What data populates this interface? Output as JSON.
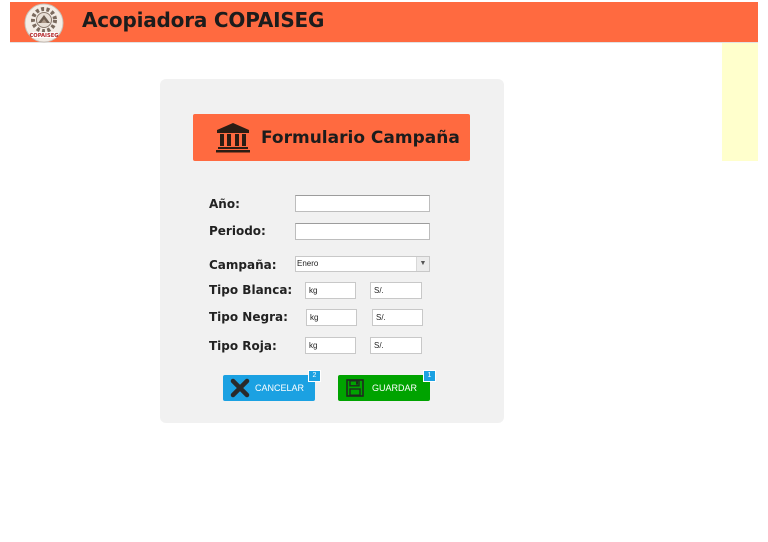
{
  "app": {
    "title": "Acopiadora COPAISEG",
    "logo_text": "COPAISEG",
    "colors": {
      "brand": "#ff6a40",
      "cancel": "#1ba1e2",
      "save": "#00a300",
      "note": "#ffffcc"
    }
  },
  "form": {
    "title": "Formulario Campaña",
    "icon": "bank-icon",
    "fields": {
      "anio_label": "Año:",
      "anio_value": "",
      "periodo_label": "Periodo:",
      "periodo_value": "",
      "campana_label": "Campaña:",
      "campana_selected": "Enero",
      "blanca_label": "Tipo Blanca:",
      "blanca_kg": "kg",
      "blanca_soles": "S/.",
      "negra_label": "Tipo Negra:",
      "negra_kg": "kg",
      "negra_soles": "S/.",
      "roja_label": "Tipo Roja:",
      "roja_kg": "kg",
      "roja_soles": "S/."
    },
    "buttons": {
      "cancel_label": "CANCELAR",
      "cancel_badge": "2",
      "cancel_icon": "close-icon",
      "save_label": "GUARDAR",
      "save_badge": "1",
      "save_icon": "floppy-disk-icon"
    }
  }
}
